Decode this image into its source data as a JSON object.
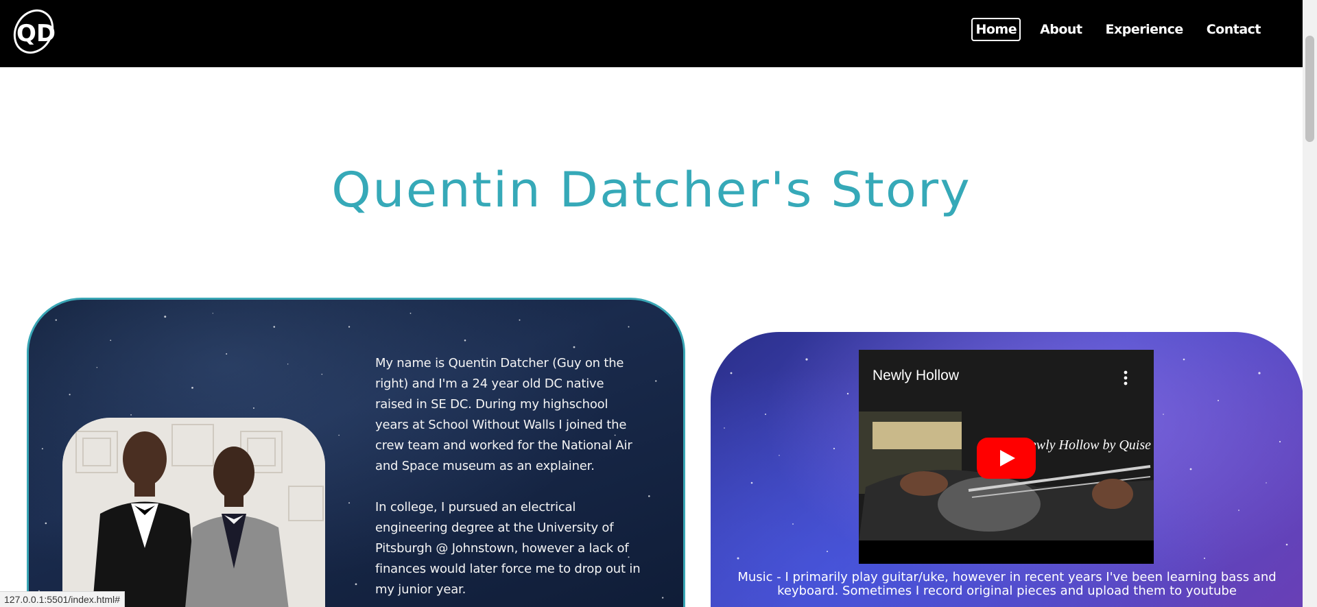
{
  "navbar": {
    "logo_text": "QD",
    "links": [
      {
        "label": "Home",
        "active": true
      },
      {
        "label": "About",
        "active": false
      },
      {
        "label": "Experience",
        "active": false
      },
      {
        "label": "Contact",
        "active": false
      }
    ]
  },
  "page": {
    "title": "Quentin Datcher's Story"
  },
  "story": {
    "paragraph1": "My name is Quentin Datcher (Guy on the right) and I'm a 24 year old DC native raised in SE DC. During my highschool years at School Without Walls I joined the crew team and worked for the National Air and Space museum as an explainer.",
    "paragraph2": "In college, I pursued an electrical engineering degree at the University of Pitsburgh @ Johnstown, however a lack of finances would later force me to drop out in my junior year."
  },
  "video": {
    "title": "Newly Hollow",
    "caption": "Newly Hollow by Quise"
  },
  "music": {
    "text": "Music - I primarily play guitar/uke, however in recent years I've been learning bass and keyboard. Sometimes I record original pieces and upload them to youtube"
  },
  "status_bar": {
    "url": "127.0.0.1:5501/index.html#"
  },
  "colors": {
    "accent": "#36a9b8",
    "navbar": "#000000"
  }
}
